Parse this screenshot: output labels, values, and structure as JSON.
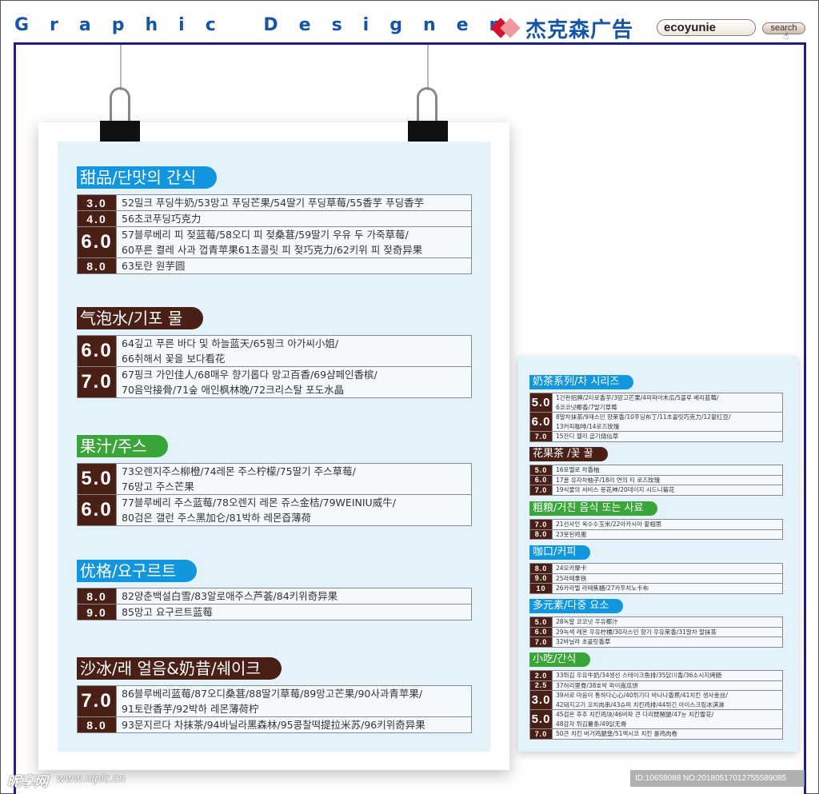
{
  "header": {
    "title": "Graphic Designer",
    "brand_name": "杰克森广告",
    "search_value": "ecoyunie",
    "search_button": "search"
  },
  "watermark": {
    "site_logo": "昵享网",
    "site_url": "www.nipic.cn",
    "id_text": "ID:10658088 NO:20180517012755589085"
  },
  "colors": {
    "header_blue": "#1455a8",
    "frame_border": "#1d1d8c",
    "title_blue": "#1296de",
    "title_brown": "#4a1f16",
    "title_green": "#3aa63a",
    "poster_bg": "#e4f2fb"
  },
  "large_menu": [
    {
      "title": "甜品/단맛의 간식",
      "color": "blue",
      "rows": [
        {
          "price": "3.0",
          "lines": [
            "52밀크 푸딩牛奶/53망고 푸딩芒果/54딸기 푸딩草莓/55香芋 푸딩香芋"
          ]
        },
        {
          "price": "4.0",
          "lines": [
            "56초코푸딩巧克力"
          ]
        },
        {
          "price": "6.0",
          "lines": [
            "57블루베리 피 젖蓝莓/58오디 피 젖桑葚/59딸기 우유 두 가죽草莓/",
            "60푸른 켤레 사과 껍青苹果61초콜릿 피 젖巧克力/62키위 피 젖奇异果"
          ]
        },
        {
          "price": "8.0",
          "lines": [
            "63토란 원芋圆"
          ]
        }
      ]
    },
    {
      "title": "气泡水/기포 물",
      "color": "brown",
      "rows": [
        {
          "price": "6.0",
          "lines": [
            "64깊고 푸른 바다 및 하늘蓝天/65핑크 아가씨小姐/",
            "66취해서 꽃을 보다看花"
          ]
        },
        {
          "price": "7.0",
          "lines": [
            "67핑크 가인佳人/68매우 향기롭다 망고百香/69샴페인香槟/",
            "70음악接骨/71숲 애인枫林晚/72크리스탈 포도水晶"
          ]
        }
      ]
    },
    {
      "title": "果汁/주스",
      "color": "green",
      "rows": [
        {
          "price": "5.0",
          "lines": [
            "73오렌지주스柳橙/74레몬 주스柠檬/75딸기 주스草莓/",
            "76망고 주스芒果"
          ]
        },
        {
          "price": "6.0",
          "lines": [
            "77블루베리 주스蓝莓/78오렌지 레몬 쥬스金桔/79WEINIU威牛/",
            "80검은 갤런 주스黑加仑/81박하 레몬즙薄荷"
          ]
        }
      ]
    },
    {
      "title": "优格/요구르트",
      "color": "blue",
      "rows": [
        {
          "price": "8.0",
          "lines": [
            "82양춘백설白雪/83알로애주스芦荟/84키위奇异果"
          ]
        },
        {
          "price": "9.0",
          "lines": [
            "85망고 요구르트蓝莓"
          ]
        }
      ]
    },
    {
      "title": "沙冰/래 얼음&奶昔/쉐이크",
      "color": "brown",
      "rows": [
        {
          "price": "7.0",
          "lines": [
            "86블루베리蓝莓/87오디桑葚/88딸기草莓/89망고芒果/90사과青苹果/",
            "91토란香芋/92박하 레몬薄荷柠"
          ]
        },
        {
          "price": "8.0",
          "lines": [
            "93문지르다 차抹茶/94바닐라黑森林/95콩찰떡提拉米苏/96키위奇异果"
          ]
        }
      ]
    }
  ],
  "small_menu": [
    {
      "title": "奶茶系列/차 시리즈",
      "color": "blue",
      "rows": [
        {
          "price": "5.0",
          "lines": [
            "1간판招牌/2타로香芋/3망고芒果/4파파야木瓜/5블루 베리蓝莓/",
            "6코코넛椰香/7딸기草莓"
          ]
        },
        {
          "price": "6.0",
          "lines": [
            "8말차抹茶/9재스민 향茉香/10푸딩布丁/11초콜릿巧克力/12팥红豆/",
            "13커피咖啡/14로즈玫瑰"
          ]
        },
        {
          "price": "7.0",
          "lines": [
            "15잔디 젤리 굽기烧仙草"
          ]
        }
      ]
    },
    {
      "title": "花果茶 /꽃 꿀",
      "color": "brown",
      "rows": [
        {
          "price": "5.0",
          "lines": [
            "16포멜로 차香柚"
          ]
        },
        {
          "price": "6.0",
          "lines": [
            "17꿀 유자차柚子/18리 연의 티 로즈玫瑰"
          ]
        },
        {
          "price": "7.0",
          "lines": [
            "19식물의 서비스 몽花神/20데이지 시드니菊花"
          ]
        }
      ]
    },
    {
      "title": "粗粮/거친 음식 또는 사료",
      "color": "green",
      "rows": [
        {
          "price": "7.0",
          "lines": [
            "21선사인 옥수수玉米/22아카시아 팥相思"
          ]
        },
        {
          "price": "8.0",
          "lines": [
            "23못된鸡蛋"
          ]
        }
      ]
    },
    {
      "title": "咖口/커피",
      "color": "blue",
      "rows": [
        {
          "price": "8.0",
          "lines": [
            "24모카摩卡"
          ]
        },
        {
          "price": "9.0",
          "lines": [
            "25라떼拿铁"
          ]
        },
        {
          "price": "10",
          "lines": [
            "26카라멜 라떼焦糖/27카푸치노卡布"
          ]
        }
      ]
    },
    {
      "title": "多元素/다중 요소",
      "color": "blue",
      "rows": [
        {
          "price": "5.0",
          "lines": [
            "28녹말 코코넛 우유椰汁"
          ]
        },
        {
          "price": "6.0",
          "lines": [
            "29녹색 레몬 우유柠檬/30자스민 향기 우유茉香/31말차 팔抹茶"
          ]
        },
        {
          "price": "7.0",
          "lines": [
            "32바닐라 초콜릿香草"
          ]
        }
      ]
    },
    {
      "title": "小吃/간식",
      "color": "green",
      "rows": [
        {
          "price": "2.0",
          "lines": [
            "33튀김 우유牛奶/34생선 스테이크鱼排/35닭川香/36소시지烤肠"
          ]
        },
        {
          "price": "2.5",
          "lines": [
            "37허리里脊/38호박 파이南瓜饼"
          ]
        },
        {
          "price": "3.0",
          "lines": [
            "39서로 마음이 통하다心心/40튀기다 바나나香蕉/41치킨 생사金丝/",
            "42돼지고기 꼬치肉串/43슈퍼 치킨鸡排/44튀긴 아이스크림冰淇淋"
          ]
        },
        {
          "price": "5.0",
          "lines": [
            "45검은 후추 치킨鸡块/46비파 큰 다리琵琶腿/47눈 치킨雪花/",
            "48감자 튀김薯条/49닭无骨"
          ]
        },
        {
          "price": "7.0",
          "lines": [
            "50큰 치킨 버거鸡腿堡/51멕시코 치킨 롤鸡肉卷"
          ]
        }
      ]
    }
  ]
}
